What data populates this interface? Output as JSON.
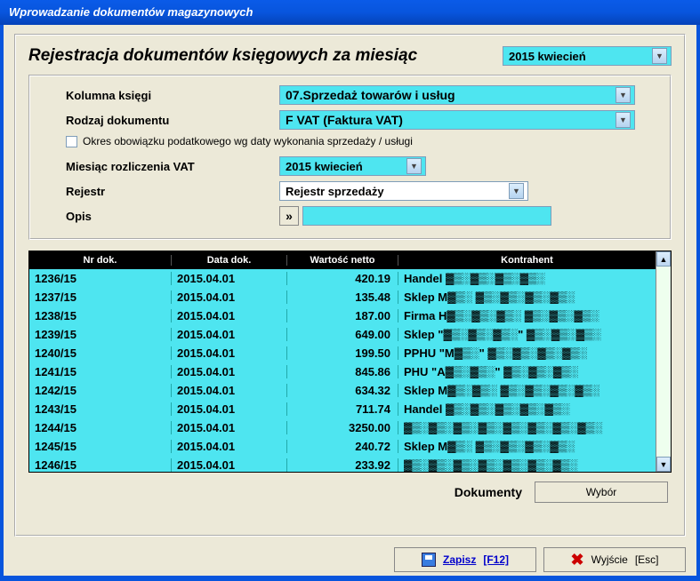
{
  "window": {
    "title": "Wprowadzanie dokumentów magazynowych"
  },
  "header": {
    "title": "Rejestracja dokumentów księgowych za miesiąc",
    "period": "2015 kwiecień"
  },
  "form": {
    "kolumna_label": "Kolumna księgi",
    "kolumna_value": "07.Sprzedaż towarów i usług",
    "rodzaj_label": "Rodzaj dokumentu",
    "rodzaj_value": "F VAT (Faktura VAT)",
    "checkbox_label": "Okres obowiązku podatkowego wg daty wykonania sprzedaży / usługi",
    "miesiac_label": "Miesiąc rozliczenia VAT",
    "miesiac_value": "2015 kwiecień",
    "rejestr_label": "Rejestr",
    "rejestr_value": "Rejestr sprzedaży",
    "opis_label": "Opis",
    "opis_btn": "»",
    "opis_value": ""
  },
  "grid": {
    "headers": {
      "c1": "Nr dok.",
      "c2": "Data dok.",
      "c3": "Wartość netto",
      "c4": "Kontrahent"
    },
    "rows": [
      {
        "nr": "1236/15",
        "data": "2015.04.01",
        "netto": "420.19",
        "kontr": "Handel ▓▒░▓▒░▓▒░▓▒░"
      },
      {
        "nr": "1237/15",
        "data": "2015.04.01",
        "netto": "135.48",
        "kontr": "Sklep M▓▒░ ▓▒░▓▒░▓▒░▓▒░"
      },
      {
        "nr": "1238/15",
        "data": "2015.04.01",
        "netto": "187.00",
        "kontr": "Firma H▓▒░▓▒░▓▒░ ▓▒░▓▒░▓▒░"
      },
      {
        "nr": "1239/15",
        "data": "2015.04.01",
        "netto": "649.00",
        "kontr": "Sklep \"▓▒░▓▒░▓▒░\" ▓▒░▓▒░▓▒░"
      },
      {
        "nr": "1240/15",
        "data": "2015.04.01",
        "netto": "199.50",
        "kontr": "PPHU \"M▓▒░\" ▓▒░▓▒░▓▒░▓▒░"
      },
      {
        "nr": "1241/15",
        "data": "2015.04.01",
        "netto": "845.86",
        "kontr": "PHU \"A▓▒░▓▒░\" ▓▒░▓▒░▓▒░"
      },
      {
        "nr": "1242/15",
        "data": "2015.04.01",
        "netto": "634.32",
        "kontr": "Sklep M▓▒░▓▒░ ▓▒░▓▒░▓▒░▓▒░"
      },
      {
        "nr": "1243/15",
        "data": "2015.04.01",
        "netto": "711.74",
        "kontr": "Handel ▓▒░▓▒░▓▒░▓▒░▓▒░"
      },
      {
        "nr": "1244/15",
        "data": "2015.04.01",
        "netto": "3250.00",
        "kontr": "▓▒░▓▒░▓▒░▓▒░▓▒░▓▒░▓▒░▓▒░"
      },
      {
        "nr": "1245/15",
        "data": "2015.04.01",
        "netto": "240.72",
        "kontr": "Sklep M▓▒░ ▓▒░▓▒░▓▒░▓▒░"
      },
      {
        "nr": "1246/15",
        "data": "2015.04.01",
        "netto": "233.92",
        "kontr": "▓▒░▓▒░▓▒░▓▒░▓▒░▓▒░▓▒░"
      }
    ]
  },
  "bottom": {
    "label": "Dokumenty",
    "btn": "Wybór"
  },
  "footer": {
    "save": "Zapisz",
    "save_key": "[F12]",
    "exit": "Wyjście",
    "exit_key": "[Esc]"
  }
}
